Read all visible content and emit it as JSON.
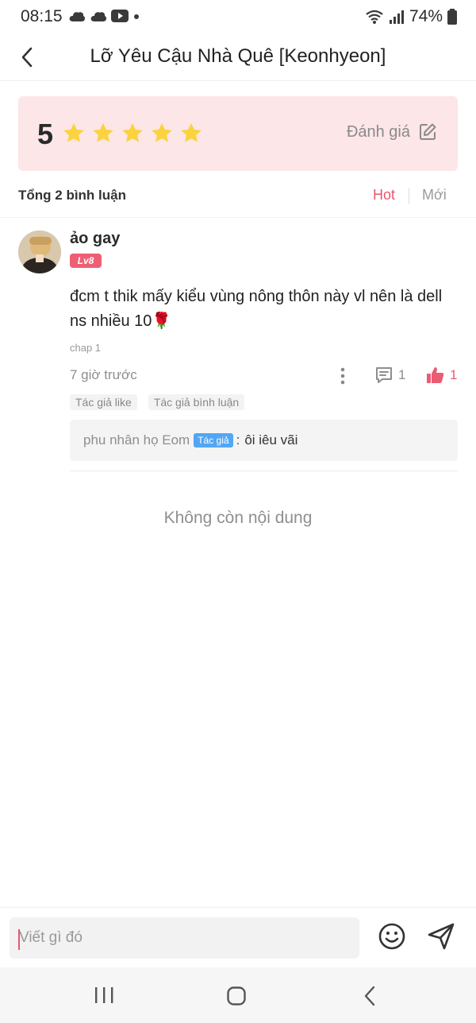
{
  "status_bar": {
    "time": "08:15",
    "battery": "74%",
    "icons_left": [
      "cloud-icon",
      "cloud-icon",
      "youtube-icon",
      "dot-icon"
    ],
    "icons_right": [
      "wifi-icon",
      "signal-icon",
      "battery-icon"
    ]
  },
  "header": {
    "title": "Lỡ Yêu Cậu Nhà Quê [Keonhyeon]"
  },
  "rating": {
    "score": "5",
    "stars": 5,
    "rate_label": "Đánh giá"
  },
  "comments_bar": {
    "total_label": "Tổng 2 bình luận",
    "sort_hot": "Hot",
    "sort_new": "Mới"
  },
  "comment": {
    "username": "ảo gay",
    "level": "Lv8",
    "text": "đcm t thik mấy kiểu vùng nông thôn này vl nên là dell ns nhiều 10🌹",
    "chapter": "chap 1",
    "time_ago": "7 giờ trước",
    "reply_count": "1",
    "like_count": "1",
    "author_tags": [
      "Tác giả like",
      "Tác giả bình luận"
    ],
    "reply": {
      "user": "phu nhân họ Eom",
      "badge": "Tác giả",
      "colon": ":",
      "text": "ôi iêu vãi"
    }
  },
  "no_more_content": "Không còn nội dung",
  "input": {
    "placeholder": "Viết gì đó"
  },
  "colors": {
    "accent": "#e8566d",
    "rating_bg": "#fde6e8",
    "star": "#fbd33f",
    "author_badge": "#52a6f4"
  }
}
